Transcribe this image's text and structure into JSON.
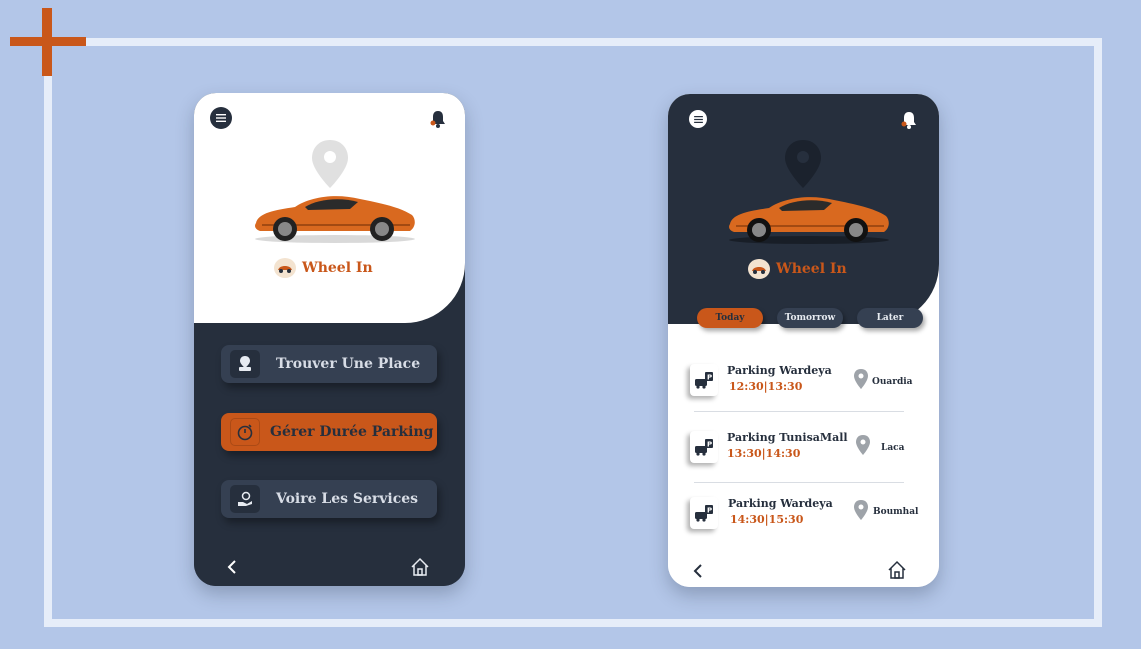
{
  "brand": {
    "name": "Wheel In",
    "accent": "#c9571a",
    "dark": "#262f3d",
    "background": "#b3c6e8"
  },
  "left_phone": {
    "menu_icon": "hamburger-icon",
    "notification_icon": "bell-icon",
    "menu_items": [
      {
        "label": "Trouver Une Place",
        "icon": "car-location-icon"
      },
      {
        "label": "Gérer Durée Parking",
        "icon": "timer-icon",
        "active": true
      },
      {
        "label": "Voire Les Services",
        "icon": "hand-service-icon"
      }
    ]
  },
  "right_phone": {
    "tabs": [
      {
        "label": "Today",
        "active": true
      },
      {
        "label": "Tomorrow"
      },
      {
        "label": "Later"
      }
    ],
    "parkings": [
      {
        "name": "Parking Wardeya",
        "time": "12:30|13:30",
        "location": "Ouardia"
      },
      {
        "name": "Parking TunisaMall",
        "time": "13:30|14:30",
        "location": "Laca"
      },
      {
        "name": "Parking Wardeya",
        "time": "14:30|15:30",
        "location": "Boumhal"
      }
    ]
  },
  "nav": {
    "back_icon": "chevron-left-icon",
    "home_icon": "home-icon"
  }
}
